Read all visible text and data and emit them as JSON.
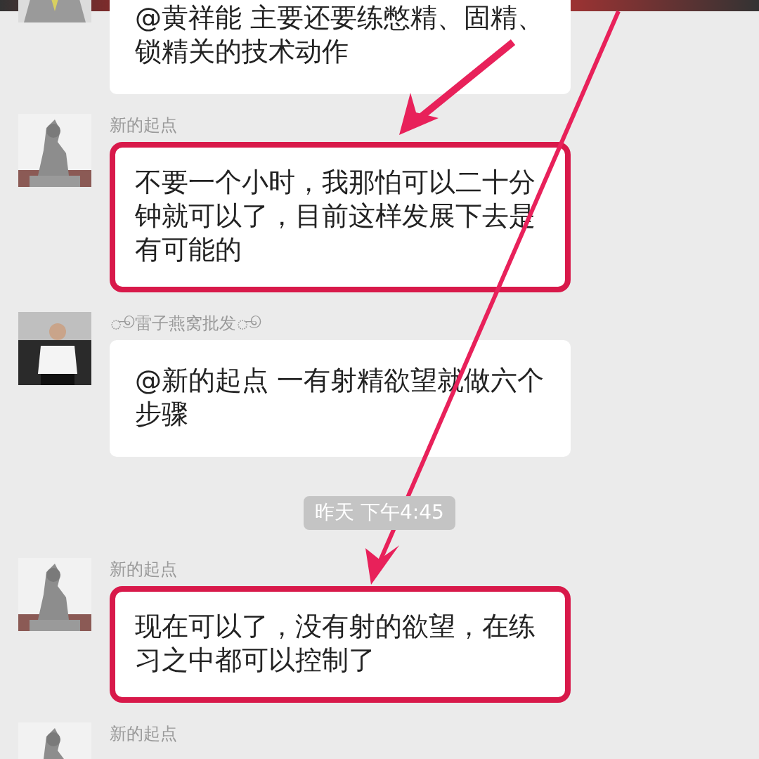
{
  "messages": [
    {
      "kind": "message",
      "text": "@黄祥能 主要还要练憋精、固精、锁精关的技术动作",
      "highlighted": false
    },
    {
      "kind": "message",
      "sender": "新的起点",
      "text": "不要一个小时，我那怕可以二十分钟就可以了，目前这样发展下去是有可能的",
      "highlighted": true
    },
    {
      "kind": "message",
      "sender": "ூ雷子燕窝批发ூ",
      "text": "@新的起点 一有射精欲望就做六个步骤",
      "highlighted": false
    },
    {
      "kind": "time",
      "text": "昨天 下午4:45"
    },
    {
      "kind": "message",
      "sender": "新的起点",
      "text": "现在可以了，没有射的欲望，在练习之中都可以控制了",
      "highlighted": true
    },
    {
      "kind": "message",
      "sender": "新的起点"
    }
  ]
}
